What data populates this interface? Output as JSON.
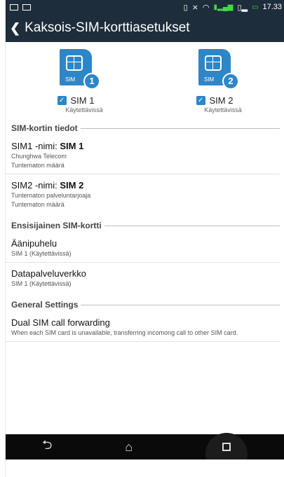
{
  "statusbar": {
    "time": "17.33"
  },
  "appbar": {
    "title": "Kaksois-SIM-korttiasetukset"
  },
  "sims": [
    {
      "card_label": "SIM",
      "number": "1",
      "name": "SIM 1",
      "status": "Käytettävissä",
      "checked": true
    },
    {
      "card_label": "SIM",
      "number": "2",
      "name": "SIM 2",
      "status": "Käytettävissä",
      "checked": true
    }
  ],
  "sections": {
    "sim_info": "SIM-kortin tiedot",
    "preferred": "Ensisijainen SIM-kortti",
    "general": "General Settings"
  },
  "sim_info_items": [
    {
      "label": "SIM1 -nimi: ",
      "name": "SIM 1",
      "line1": "Chunghwa Telecom",
      "line2": "Tuntematon määrä"
    },
    {
      "label": "SIM2 -nimi: ",
      "name": "SIM 2",
      "line1": "Tuntematon palveluntarjoaja",
      "line2": "Tuntematon määrä"
    }
  ],
  "preferred_items": [
    {
      "title": "Äänipuhelu",
      "sub": "SIM 1 (Käytettävissä)"
    },
    {
      "title": "Datapalveluverkko",
      "sub": "SIM 1 (Käytettävissä)"
    }
  ],
  "general_items": [
    {
      "title": "Dual SIM call forwarding",
      "sub": "When each SIM card is unavailable, transferring incomong call to other SIM card."
    }
  ],
  "icons": {
    "back": "back-arrow-icon",
    "nav_back": "nav-back-icon",
    "nav_home": "nav-home-icon",
    "nav_recent": "nav-recent-icon"
  },
  "colors": {
    "accent": "#2e86c7",
    "bar": "#1e2d3b"
  }
}
